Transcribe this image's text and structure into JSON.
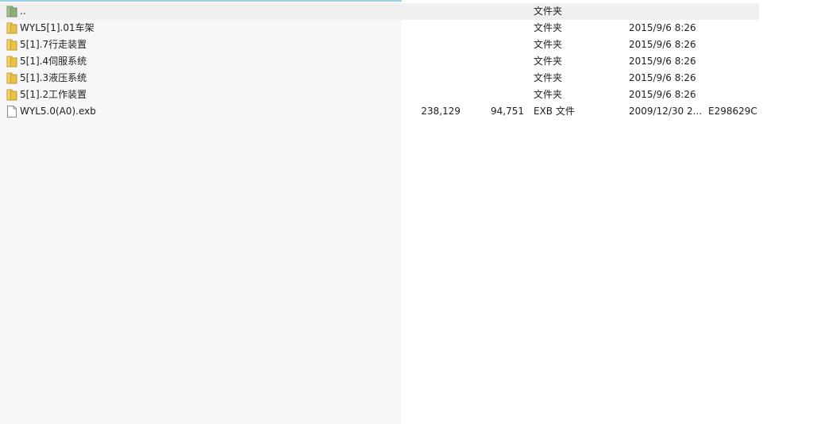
{
  "file_list": {
    "rows": [
      {
        "kind": "parent",
        "icon": "parent-folder-icon",
        "name": "..",
        "size": "",
        "packed": "",
        "type": "文件夹",
        "modified": "",
        "crc": ""
      },
      {
        "kind": "folder",
        "icon": "folder-icon",
        "name": "WYL5[1].01车架",
        "size": "",
        "packed": "",
        "type": "文件夹",
        "modified": "2015/9/6 8:26",
        "crc": ""
      },
      {
        "kind": "folder",
        "icon": "folder-icon",
        "name": "5[1].7行走装置",
        "size": "",
        "packed": "",
        "type": "文件夹",
        "modified": "2015/9/6 8:26",
        "crc": ""
      },
      {
        "kind": "folder",
        "icon": "folder-icon",
        "name": "5[1].4伺服系统",
        "size": "",
        "packed": "",
        "type": "文件夹",
        "modified": "2015/9/6 8:26",
        "crc": ""
      },
      {
        "kind": "folder",
        "icon": "folder-icon",
        "name": "5[1].3液压系统",
        "size": "",
        "packed": "",
        "type": "文件夹",
        "modified": "2015/9/6 8:26",
        "crc": ""
      },
      {
        "kind": "folder",
        "icon": "folder-icon",
        "name": "5[1].2工作装置",
        "size": "",
        "packed": "",
        "type": "文件夹",
        "modified": "2015/9/6 8:26",
        "crc": ""
      },
      {
        "kind": "file",
        "icon": "file-icon",
        "name": "WYL5.0(A0).exb",
        "size": "238,129",
        "packed": "94,751",
        "type": "EXB 文件",
        "modified": "2009/12/30 2...",
        "crc": "E298629C"
      }
    ]
  },
  "colors": {
    "folder_yellow": "#e8c04a",
    "parent_folder_green": "#8fb07a",
    "selected_row_bg": "#f0f0f0",
    "name_column_bg": "#f7f7f7",
    "top_border": "#99d0e8"
  }
}
